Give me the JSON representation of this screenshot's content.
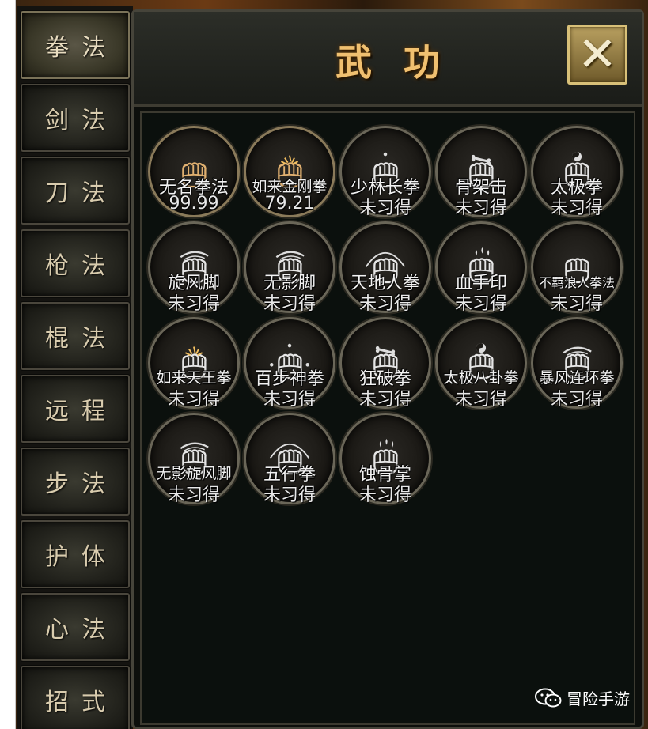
{
  "panel": {
    "title": "武功",
    "close_label": "✕"
  },
  "sidebar": {
    "tabs": [
      {
        "label": "拳法",
        "active": true
      },
      {
        "label": "剑法"
      },
      {
        "label": "刀法"
      },
      {
        "label": "枪法"
      },
      {
        "label": "棍法"
      },
      {
        "label": "远程"
      },
      {
        "label": "步法"
      },
      {
        "label": "护体"
      },
      {
        "label": "心法"
      },
      {
        "label": "招式"
      }
    ]
  },
  "skills": [
    {
      "name": "无名拳法",
      "status": "99.99",
      "icon": "fist-icon",
      "learned": true
    },
    {
      "name": "如来金刚拳",
      "status": "79.21",
      "icon": "fist-burst-icon",
      "learned": true
    },
    {
      "name": "少林长拳",
      "status": "未习得",
      "icon": "fist-dot-icon"
    },
    {
      "name": "骨架击",
      "status": "未习得",
      "icon": "fist-bone-icon"
    },
    {
      "name": "太极拳",
      "status": "未习得",
      "icon": "fist-yinyang-icon"
    },
    {
      "name": "旋风脚",
      "status": "未习得",
      "icon": "fist-wind-icon"
    },
    {
      "name": "无影脚",
      "status": "未习得",
      "icon": "fist-wind-icon"
    },
    {
      "name": "天地人拳",
      "status": "未习得",
      "icon": "fist-arc-icon"
    },
    {
      "name": "血手印",
      "status": "未习得",
      "icon": "fist-drops-icon"
    },
    {
      "name": "不羁浪人拳法",
      "status": "未习得",
      "icon": "fist-icon"
    },
    {
      "name": "如来天王拳",
      "status": "未习得",
      "icon": "fist-burst-icon"
    },
    {
      "name": "百步神拳",
      "status": "未习得",
      "icon": "fist-dots-icon"
    },
    {
      "name": "狂破拳",
      "status": "未习得",
      "icon": "fist-bone-icon"
    },
    {
      "name": "太极八卦拳",
      "status": "未习得",
      "icon": "fist-yinyang-icon"
    },
    {
      "name": "暴风连环拳",
      "status": "未习得",
      "icon": "fist-wind-icon"
    },
    {
      "name": "无影旋风脚",
      "status": "未习得",
      "icon": "fist-wind-icon"
    },
    {
      "name": "五行拳",
      "status": "未习得",
      "icon": "fist-arc-icon"
    },
    {
      "name": "蚀骨掌",
      "status": "未习得",
      "icon": "fist-drops-icon"
    }
  ],
  "watermark": {
    "text": "冒险手游",
    "icon": "wechat-icon"
  },
  "colors": {
    "title": "#f0c070",
    "accent": "#d8c078",
    "text": "#f2f2f2"
  }
}
